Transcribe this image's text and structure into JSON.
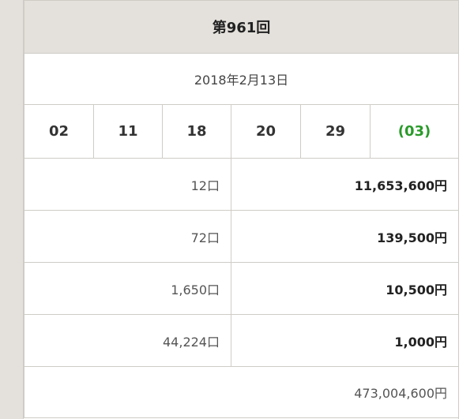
{
  "draw": {
    "title": "第961回",
    "date": "2018年2月13日"
  },
  "numbers": {
    "main": [
      "02",
      "11",
      "18",
      "20",
      "29"
    ],
    "bonus": "(03)"
  },
  "prizes": [
    {
      "winners": "12口",
      "amount": "11,653,600円"
    },
    {
      "winners": "72口",
      "amount": "139,500円"
    },
    {
      "winners": "1,650口",
      "amount": "10,500円"
    },
    {
      "winners": "44,224口",
      "amount": "1,000円"
    }
  ],
  "carryover": "473,004,600円",
  "colors": {
    "header_bg": "#e4e1dc",
    "border": "#cfccc6",
    "bonus_number": "#2a9a2a"
  }
}
